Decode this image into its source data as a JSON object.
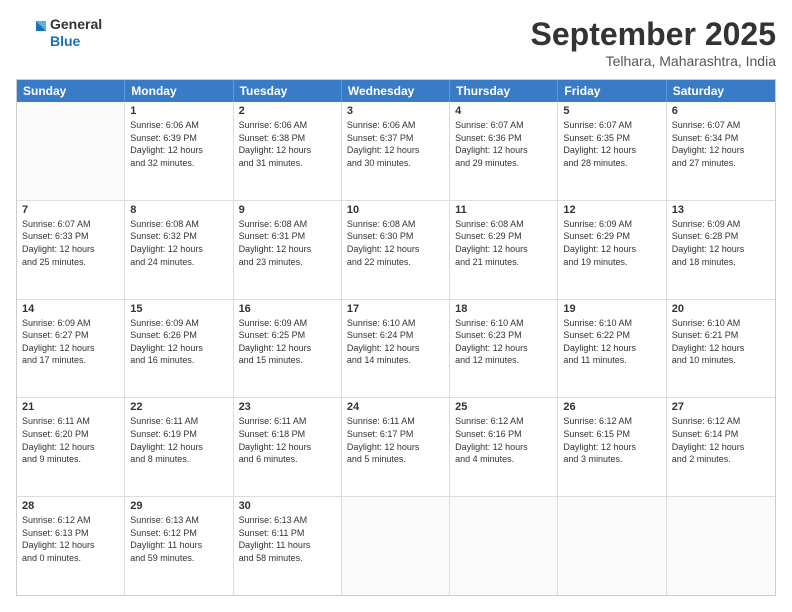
{
  "header": {
    "logo_line1": "General",
    "logo_line2": "Blue",
    "month": "September 2025",
    "location": "Telhara, Maharashtra, India"
  },
  "weekdays": [
    "Sunday",
    "Monday",
    "Tuesday",
    "Wednesday",
    "Thursday",
    "Friday",
    "Saturday"
  ],
  "rows": [
    [
      {
        "day": "",
        "info": ""
      },
      {
        "day": "1",
        "info": "Sunrise: 6:06 AM\nSunset: 6:39 PM\nDaylight: 12 hours\nand 32 minutes."
      },
      {
        "day": "2",
        "info": "Sunrise: 6:06 AM\nSunset: 6:38 PM\nDaylight: 12 hours\nand 31 minutes."
      },
      {
        "day": "3",
        "info": "Sunrise: 6:06 AM\nSunset: 6:37 PM\nDaylight: 12 hours\nand 30 minutes."
      },
      {
        "day": "4",
        "info": "Sunrise: 6:07 AM\nSunset: 6:36 PM\nDaylight: 12 hours\nand 29 minutes."
      },
      {
        "day": "5",
        "info": "Sunrise: 6:07 AM\nSunset: 6:35 PM\nDaylight: 12 hours\nand 28 minutes."
      },
      {
        "day": "6",
        "info": "Sunrise: 6:07 AM\nSunset: 6:34 PM\nDaylight: 12 hours\nand 27 minutes."
      }
    ],
    [
      {
        "day": "7",
        "info": "Sunrise: 6:07 AM\nSunset: 6:33 PM\nDaylight: 12 hours\nand 25 minutes."
      },
      {
        "day": "8",
        "info": "Sunrise: 6:08 AM\nSunset: 6:32 PM\nDaylight: 12 hours\nand 24 minutes."
      },
      {
        "day": "9",
        "info": "Sunrise: 6:08 AM\nSunset: 6:31 PM\nDaylight: 12 hours\nand 23 minutes."
      },
      {
        "day": "10",
        "info": "Sunrise: 6:08 AM\nSunset: 6:30 PM\nDaylight: 12 hours\nand 22 minutes."
      },
      {
        "day": "11",
        "info": "Sunrise: 6:08 AM\nSunset: 6:29 PM\nDaylight: 12 hours\nand 21 minutes."
      },
      {
        "day": "12",
        "info": "Sunrise: 6:09 AM\nSunset: 6:29 PM\nDaylight: 12 hours\nand 19 minutes."
      },
      {
        "day": "13",
        "info": "Sunrise: 6:09 AM\nSunset: 6:28 PM\nDaylight: 12 hours\nand 18 minutes."
      }
    ],
    [
      {
        "day": "14",
        "info": "Sunrise: 6:09 AM\nSunset: 6:27 PM\nDaylight: 12 hours\nand 17 minutes."
      },
      {
        "day": "15",
        "info": "Sunrise: 6:09 AM\nSunset: 6:26 PM\nDaylight: 12 hours\nand 16 minutes."
      },
      {
        "day": "16",
        "info": "Sunrise: 6:09 AM\nSunset: 6:25 PM\nDaylight: 12 hours\nand 15 minutes."
      },
      {
        "day": "17",
        "info": "Sunrise: 6:10 AM\nSunset: 6:24 PM\nDaylight: 12 hours\nand 14 minutes."
      },
      {
        "day": "18",
        "info": "Sunrise: 6:10 AM\nSunset: 6:23 PM\nDaylight: 12 hours\nand 12 minutes."
      },
      {
        "day": "19",
        "info": "Sunrise: 6:10 AM\nSunset: 6:22 PM\nDaylight: 12 hours\nand 11 minutes."
      },
      {
        "day": "20",
        "info": "Sunrise: 6:10 AM\nSunset: 6:21 PM\nDaylight: 12 hours\nand 10 minutes."
      }
    ],
    [
      {
        "day": "21",
        "info": "Sunrise: 6:11 AM\nSunset: 6:20 PM\nDaylight: 12 hours\nand 9 minutes."
      },
      {
        "day": "22",
        "info": "Sunrise: 6:11 AM\nSunset: 6:19 PM\nDaylight: 12 hours\nand 8 minutes."
      },
      {
        "day": "23",
        "info": "Sunrise: 6:11 AM\nSunset: 6:18 PM\nDaylight: 12 hours\nand 6 minutes."
      },
      {
        "day": "24",
        "info": "Sunrise: 6:11 AM\nSunset: 6:17 PM\nDaylight: 12 hours\nand 5 minutes."
      },
      {
        "day": "25",
        "info": "Sunrise: 6:12 AM\nSunset: 6:16 PM\nDaylight: 12 hours\nand 4 minutes."
      },
      {
        "day": "26",
        "info": "Sunrise: 6:12 AM\nSunset: 6:15 PM\nDaylight: 12 hours\nand 3 minutes."
      },
      {
        "day": "27",
        "info": "Sunrise: 6:12 AM\nSunset: 6:14 PM\nDaylight: 12 hours\nand 2 minutes."
      }
    ],
    [
      {
        "day": "28",
        "info": "Sunrise: 6:12 AM\nSunset: 6:13 PM\nDaylight: 12 hours\nand 0 minutes."
      },
      {
        "day": "29",
        "info": "Sunrise: 6:13 AM\nSunset: 6:12 PM\nDaylight: 11 hours\nand 59 minutes."
      },
      {
        "day": "30",
        "info": "Sunrise: 6:13 AM\nSunset: 6:11 PM\nDaylight: 11 hours\nand 58 minutes."
      },
      {
        "day": "",
        "info": ""
      },
      {
        "day": "",
        "info": ""
      },
      {
        "day": "",
        "info": ""
      },
      {
        "day": "",
        "info": ""
      }
    ]
  ]
}
